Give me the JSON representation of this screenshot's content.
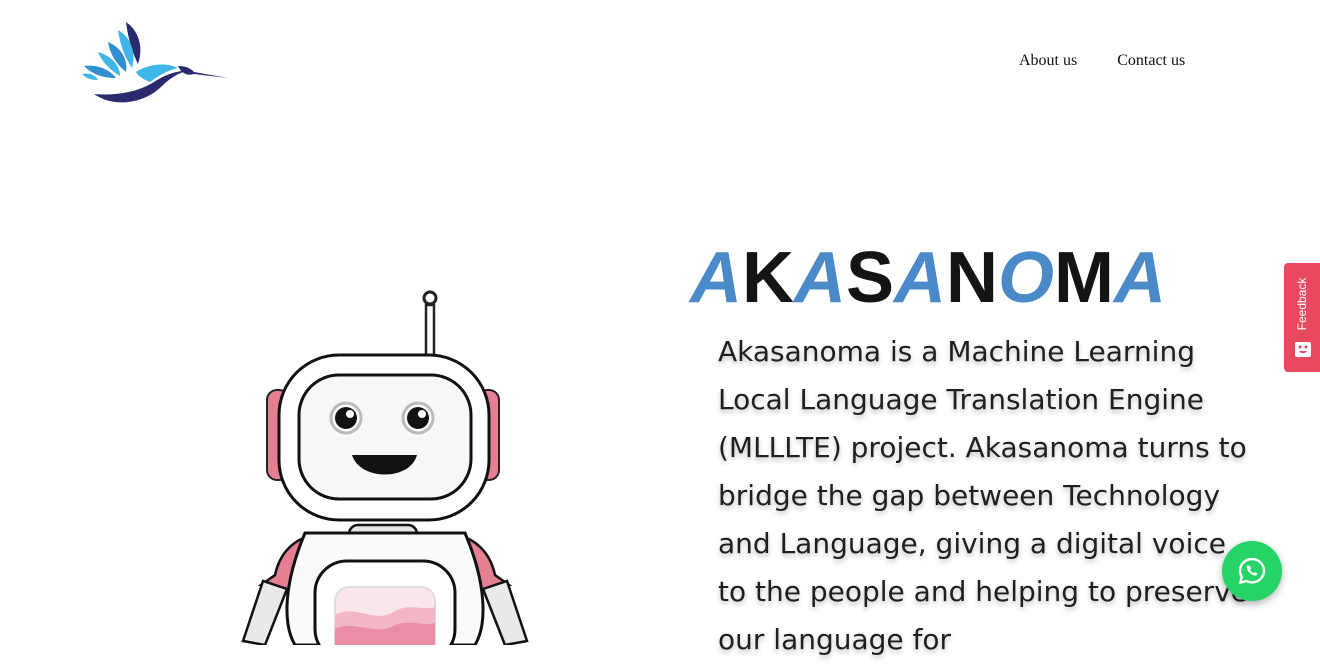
{
  "header": {
    "logo_icon": "hummingbird-logo-icon",
    "nav": [
      {
        "label": "About us"
      },
      {
        "label": "Contact us"
      }
    ]
  },
  "hero": {
    "brand_letters": [
      "A",
      "K",
      "A",
      "S",
      "A",
      "N",
      "O",
      "M",
      "A"
    ],
    "description": "Akasanoma is a Machine Learning Local Language Translation Engine (MLLLTE) project. Akasanoma turns to bridge the gap between Technology and Language, giving a digital voice to the people and helping to preserve our language for",
    "illustration_icon": "robot-illustration"
  },
  "feedback_tab": {
    "label": "Feedback",
    "icon": "feedback-face-icon"
  },
  "whatsapp_button": {
    "icon": "whatsapp-icon"
  },
  "colors": {
    "brand_blue": "#4a8ac9",
    "brand_dark": "#141414",
    "feedback_red": "#e8495e",
    "whatsapp_green": "#25d366"
  }
}
